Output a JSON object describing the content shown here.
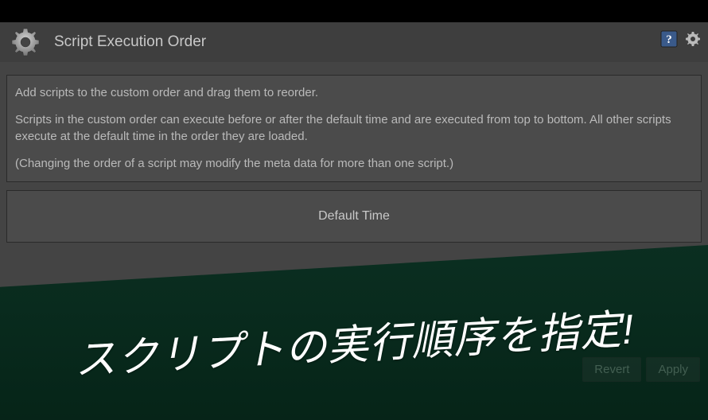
{
  "header": {
    "title": "Script Execution Order"
  },
  "info": {
    "line1": "Add scripts to the custom order and drag them to reorder.",
    "line2": "Scripts in the custom order can execute before or after the default time and are executed from top to bottom. All other scripts execute at the default time in the order they are loaded.",
    "line3": "(Changing the order of a script may modify the meta data for more than one script.)"
  },
  "defaultTime": {
    "label": "Default Time"
  },
  "buttons": {
    "revert": "Revert",
    "apply": "Apply"
  },
  "overlay": {
    "text": "スクリプトの実行順序を指定!"
  }
}
